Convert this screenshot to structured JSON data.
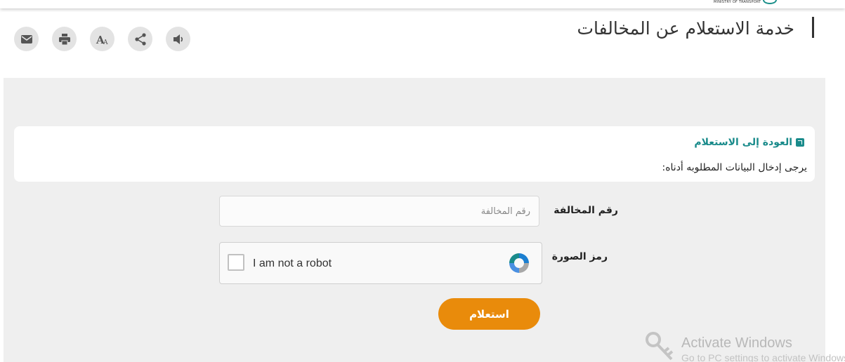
{
  "header": {
    "ministry_text": "MINISTRY OF TRANSPORT",
    "page_title": "خدمة الاستعلام عن المخالفات"
  },
  "tools": [
    {
      "name": "email",
      "icon": "envelope-icon"
    },
    {
      "name": "print",
      "icon": "printer-icon"
    },
    {
      "name": "font-size",
      "icon": "font-size-icon"
    },
    {
      "name": "share",
      "icon": "share-icon"
    },
    {
      "name": "audio",
      "icon": "speaker-icon"
    }
  ],
  "info": {
    "back_link": "العودة إلى الاستعلام",
    "instructions": "يرجى إدخال البيانات المطلوبه أدناه:"
  },
  "form": {
    "violation_label": "رقم المخالفة",
    "violation_placeholder": "رقم المخالفة",
    "violation_value": "",
    "captcha_label": "رمز الصورة",
    "recaptcha_text": "I am not a robot",
    "submit_label": "استعلام"
  },
  "watermark": {
    "title": "Activate Windows",
    "subtitle": "Go to PC settings to activate Windows."
  },
  "colors": {
    "accent_teal": "#1a8b8b",
    "submit_orange": "#e98b0b",
    "panel_gray": "#efefef"
  }
}
